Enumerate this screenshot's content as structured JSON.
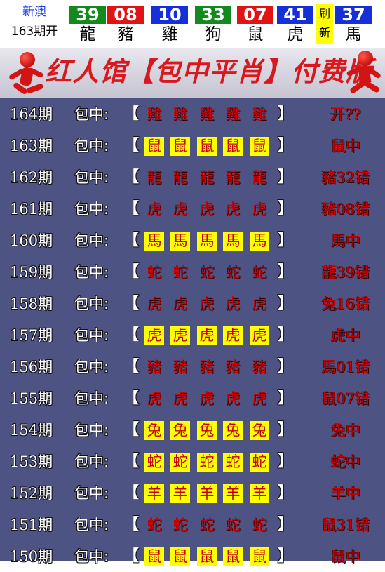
{
  "header": {
    "brand_line1": "新澳",
    "brand_line2": "163期开",
    "balls": [
      {
        "number": "39",
        "zodiac": "龍",
        "color": "#138a1e"
      },
      {
        "number": "08",
        "zodiac": "豬",
        "color": "#e01414"
      },
      {
        "number": "10",
        "zodiac": "雞",
        "color": "#1530d8"
      },
      {
        "number": "33",
        "zodiac": "狗",
        "color": "#138a1e"
      },
      {
        "number": "07",
        "zodiac": "鼠",
        "color": "#e01414"
      },
      {
        "number": "41",
        "zodiac": "虎",
        "color": "#1530d8"
      },
      {
        "number": "37",
        "zodiac": "馬",
        "color": "#1530d8"
      }
    ],
    "refresh_label_top": "刷",
    "refresh_label_bottom": "新"
  },
  "banner": {
    "title": "红人馆【包中平肖】付费版"
  },
  "rows_label": "包中:",
  "bracket_open": "【",
  "bracket_close": "】",
  "rows": [
    {
      "period": "164期",
      "zodiac": "雞",
      "result": "开??",
      "highlight": false
    },
    {
      "period": "163期",
      "zodiac": "鼠",
      "result": "鼠中",
      "highlight": true
    },
    {
      "period": "162期",
      "zodiac": "龍",
      "result": "豬32错",
      "highlight": false
    },
    {
      "period": "161期",
      "zodiac": "虎",
      "result": "豬08错",
      "highlight": false
    },
    {
      "period": "160期",
      "zodiac": "馬",
      "result": "馬中",
      "highlight": true
    },
    {
      "period": "159期",
      "zodiac": "蛇",
      "result": "龍39错",
      "highlight": false
    },
    {
      "period": "158期",
      "zodiac": "虎",
      "result": "兔16错",
      "highlight": false
    },
    {
      "period": "157期",
      "zodiac": "虎",
      "result": "虎中",
      "highlight": true
    },
    {
      "period": "156期",
      "zodiac": "豬",
      "result": "馬01错",
      "highlight": false
    },
    {
      "period": "155期",
      "zodiac": "虎",
      "result": "鼠07错",
      "highlight": false
    },
    {
      "period": "154期",
      "zodiac": "兔",
      "result": "兔中",
      "highlight": true
    },
    {
      "period": "153期",
      "zodiac": "蛇",
      "result": "蛇中",
      "highlight": true
    },
    {
      "period": "152期",
      "zodiac": "羊",
      "result": "羊中",
      "highlight": true
    },
    {
      "period": "151期",
      "zodiac": "蛇",
      "result": "鼠31错",
      "highlight": false
    },
    {
      "period": "150期",
      "zodiac": "鼠",
      "result": "鼠中",
      "highlight": true
    }
  ]
}
